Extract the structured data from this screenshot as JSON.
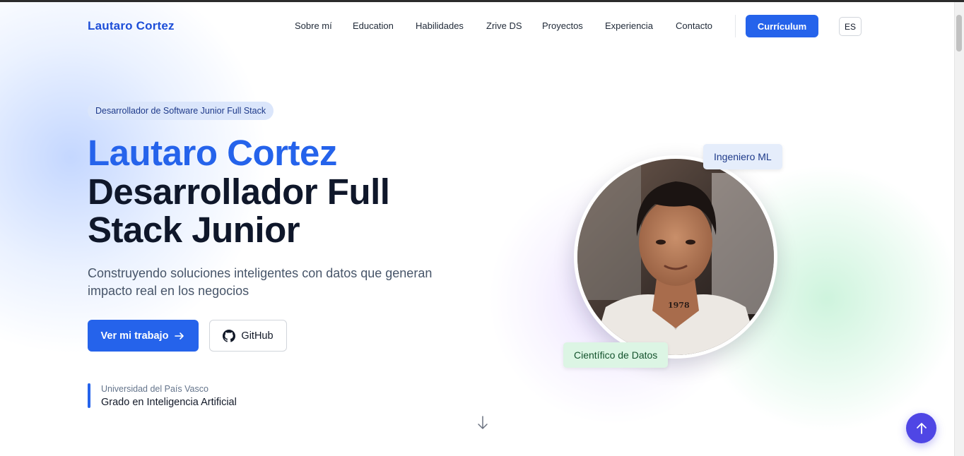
{
  "header": {
    "logo": "Lautaro Cortez",
    "nav": [
      {
        "label": "Sobre mí"
      },
      {
        "label": "Education"
      },
      {
        "label": "Habilidades"
      },
      {
        "label": "Zrive DS"
      },
      {
        "label": "Proyectos"
      },
      {
        "label": "Experiencia"
      },
      {
        "label": "Contacto"
      }
    ],
    "cv_button": "Currículum",
    "language": "ES"
  },
  "hero": {
    "badge": "Desarrollador de Software Junior Full Stack",
    "name": "Lautaro Cortez",
    "role": "Desarrollador Full Stack Junior",
    "subtitle": "Construyendo soluciones inteligentes con datos que generan impacto real en los negocios",
    "primary_button": "Ver mi trabajo",
    "secondary_button": "GitHub",
    "education": {
      "university": "Universidad del País Vasco",
      "degree": "Grado en Inteligencia Artificial"
    }
  },
  "profile": {
    "tag_top": "Ingeniero ML",
    "tag_bottom": "Científico de Datos",
    "photo_text": "1978"
  },
  "icons": {
    "primary_arrow": "arrow-right-icon",
    "github": "github-icon",
    "scroll": "arrow-down-icon",
    "back_to_top": "arrow-up-icon"
  },
  "colors": {
    "accent": "#2563eb",
    "fab": "#4f46e5",
    "heading": "#0f172a"
  }
}
